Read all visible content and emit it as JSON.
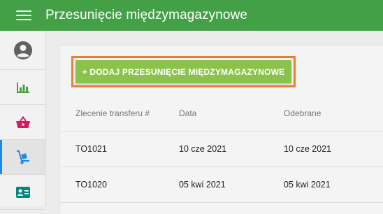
{
  "header": {
    "title": "Przesunięcie międzymagazynowe"
  },
  "sidebar": {
    "items": [
      {
        "icon": "user-avatar-icon",
        "active": false
      },
      {
        "icon": "bar-chart-icon",
        "active": false
      },
      {
        "icon": "shopping-basket-icon",
        "active": false
      },
      {
        "icon": "hand-truck-icon",
        "active": true
      },
      {
        "icon": "contact-card-icon",
        "active": false
      }
    ]
  },
  "main": {
    "add_button_label": "+ DODAJ PRZESUNIĘCIE MIĘDZYMAGAZYNOWE",
    "table": {
      "columns": [
        "Zlecenie transferu #",
        "Data",
        "Odebrane"
      ],
      "rows": [
        [
          "TO1021",
          "10 cze 2021",
          "10 cze 2021"
        ],
        [
          "TO1020",
          "05 kwi 2021",
          "05 kwi 2021"
        ]
      ]
    }
  },
  "colors": {
    "header_bg": "#43a047",
    "button_bg": "#8bc34a",
    "highlight_border": "#ed7d31",
    "active_indicator": "#1e88e5"
  }
}
